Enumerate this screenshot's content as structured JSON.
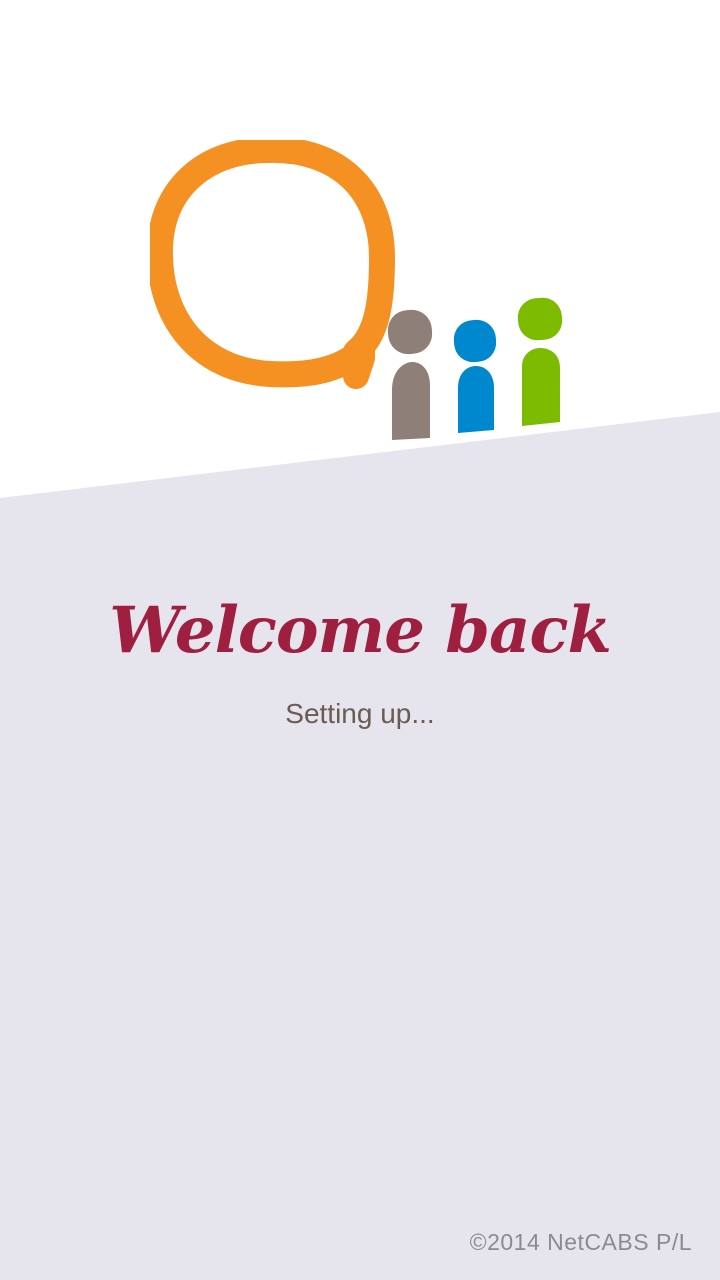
{
  "welcome": {
    "title": "Welcome back",
    "status": "Setting up..."
  },
  "footer": {
    "copyright": "©2014 NetCABS P/L"
  },
  "colors": {
    "background_top": "#ffffff",
    "background_bottom": "#e6e4ed",
    "title": "#9e1f3f",
    "status": "#6b5b53",
    "copyright": "#8c8a90",
    "logo_orange": "#f59122",
    "logo_gray": "#8e8078",
    "logo_blue": "#0088cf",
    "logo_green": "#7cbb00"
  },
  "icons": {
    "app_logo": "speech-bubble-with-three-people-icon"
  }
}
